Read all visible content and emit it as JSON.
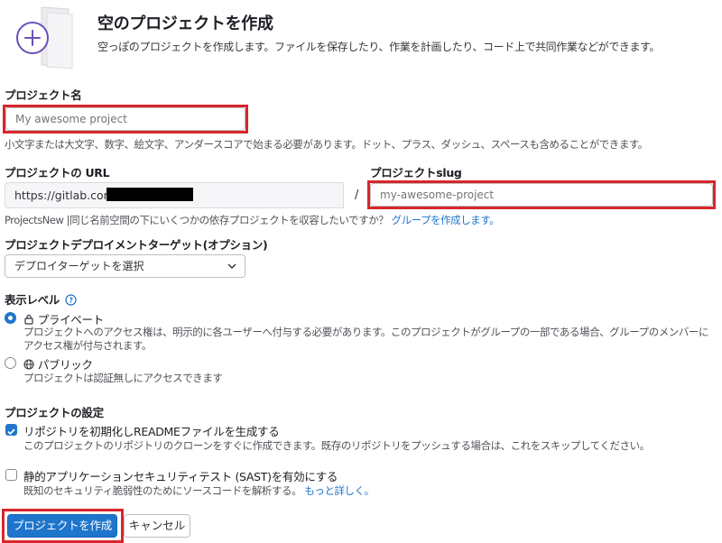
{
  "header": {
    "title": "空のプロジェクトを作成",
    "subtitle": "空っぽのプロジェクトを作成します。ファイルを保存したり、作業を計画したり、コード上で共同作業などができます。",
    "icon": "plus-document-icon"
  },
  "project_name": {
    "label": "プロジェクト名",
    "placeholder": "My awesome project",
    "help": "小文字または大文字、数字、絵文字、アンダースコアで始まる必要があります。ドット、プラス、ダッシュ、スペースも含めることができます。"
  },
  "project_url": {
    "label": "プロジェクトの URL",
    "prefix": "https://gitlab.com/",
    "separator": "/"
  },
  "project_slug": {
    "label": "プロジェクトslug",
    "placeholder": "my-awesome-project"
  },
  "group_hint": {
    "prefix": "ProjectsNew |同じ名前空間の下にいくつかの依存プロジェクトを収容したいですか？",
    "link": "グループを作成します。"
  },
  "deploy_target": {
    "label": "プロジェクトデプロイメントターゲット(オプション)",
    "selected": "デプロイターゲットを選択"
  },
  "visibility": {
    "label": "表示レベル",
    "options": [
      {
        "label": "プライベート",
        "icon": "lock-icon",
        "description": "プロジェクトへのアクセス権は、明示的に各ユーザーへ付与する必要があります。このプロジェクトがグループの一部である場合、グループのメンバーにアクセス権が付与されます。",
        "selected": true
      },
      {
        "label": "パブリック",
        "icon": "globe-icon",
        "description": "プロジェクトは認証無しにアクセスできます",
        "selected": false
      }
    ]
  },
  "settings": {
    "label": "プロジェクトの設定",
    "readme": {
      "label": "リポジトリを初期化しREADMEファイルを生成する",
      "description": "このプロジェクトのリポジトリのクローンをすぐに作成できます。既存のリポジトリをプッシュする場合は、これをスキップしてください。",
      "checked": true
    },
    "sast": {
      "label": "静的アプリケーションセキュリティテスト (SAST)を有効にする",
      "description": "既知のセキュリティ脆弱性のためにソースコードを解析する。",
      "link": "もっと詳しく。",
      "checked": false
    }
  },
  "buttons": {
    "create": "プロジェクトを作成",
    "cancel": "キャンセル"
  },
  "colors": {
    "accent": "#1f75cb",
    "highlight": "#d9252b",
    "text": "#333238"
  }
}
